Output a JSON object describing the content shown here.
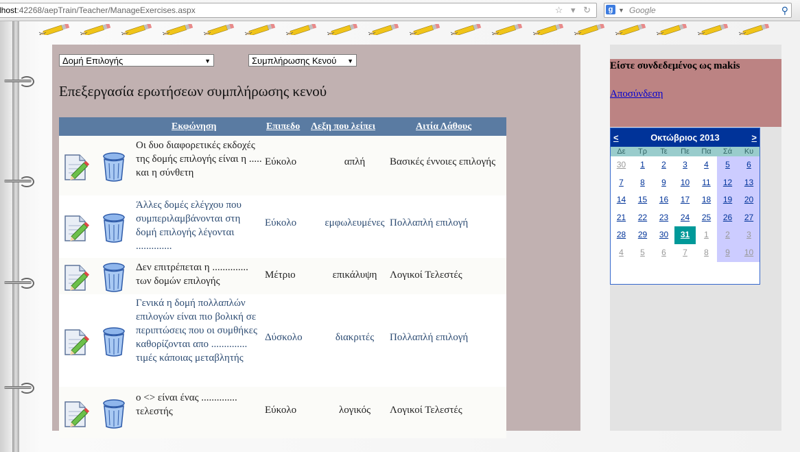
{
  "browser": {
    "url_host": "lhost",
    "url_rest": ":42268/aepTrain/Teacher/ManageExercises.aspx",
    "search_placeholder": "Google"
  },
  "filters": {
    "structure_value": "Δομή Επιλογής",
    "type_value": "Συμπλήρωσης Κενού"
  },
  "title": "Επεξεργασία ερωτήσεων συμπλήρωσης κενού",
  "grid": {
    "headers": [
      "Εκφώνηση",
      "Επιπεδο",
      "Λεξη που λείπει",
      "Αιτία Λάθους"
    ],
    "rows": [
      {
        "question": "Οι δυο διαφορετικές εκδοχές της δομής επιλογής είναι η ..... και η σύνθετη",
        "level": "Εύκολο",
        "word": "απλή",
        "reason": "Βασικές έννοιες επιλογής"
      },
      {
        "question": "Άλλες δομές ελέγχου που συμπεριλαμβάνονται στη δομή επιλογής λέγονται ..............",
        "level": "Εύκολο",
        "word": "εμφωλευμένες",
        "reason": "Πολλαπλή επιλογή"
      },
      {
        "question": "Δεν επιτρέπεται η .............. των δομών επιλογής",
        "level": "Μέτριο",
        "word": "επικάλυψη",
        "reason": "Λογικοί Τελεστές"
      },
      {
        "question": "Γενικά η δομή πολλαπλών επιλογών είναι πιο βολική σε περιπτώσεις που οι συμθήκες καθορίζονται απο .............. τιμές κάποιας μεταβλητής",
        "level": "Δύσκολο",
        "word": "διακριτές",
        "reason": "Πολλαπλή επιλογή"
      },
      {
        "question": "ο <> είναι ένας .............. τελεστής",
        "level": "Εύκολο",
        "word": "λογικός",
        "reason": "Λογικοί Τελεστές"
      }
    ]
  },
  "login": {
    "text": "Είστε συνδεδεμένος ως makis",
    "logout": "Αποσύνδεση"
  },
  "calendar": {
    "prev": "<",
    "next": ">",
    "title": "Οκτώβριος 2013",
    "dow": [
      "Δε",
      "Τρ",
      "Τε",
      "Πε",
      "Πα",
      "Σά",
      "Κυ"
    ],
    "weeks": [
      [
        "30",
        "1",
        "2",
        "3",
        "4",
        "5",
        "6"
      ],
      [
        "7",
        "8",
        "9",
        "10",
        "11",
        "12",
        "13"
      ],
      [
        "14",
        "15",
        "16",
        "17",
        "18",
        "19",
        "20"
      ],
      [
        "21",
        "22",
        "23",
        "24",
        "25",
        "26",
        "27"
      ],
      [
        "28",
        "29",
        "30",
        "31",
        "1",
        "2",
        "3"
      ],
      [
        "4",
        "5",
        "6",
        "7",
        "8",
        "9",
        "10"
      ]
    ],
    "selected_day": "31",
    "colors": {
      "header": "#003399",
      "dow": "#99cccc",
      "weekend": "#ccccff",
      "selected": "#009999"
    }
  },
  "icons": {
    "edit": "edit-icon",
    "delete": "trash-icon"
  }
}
